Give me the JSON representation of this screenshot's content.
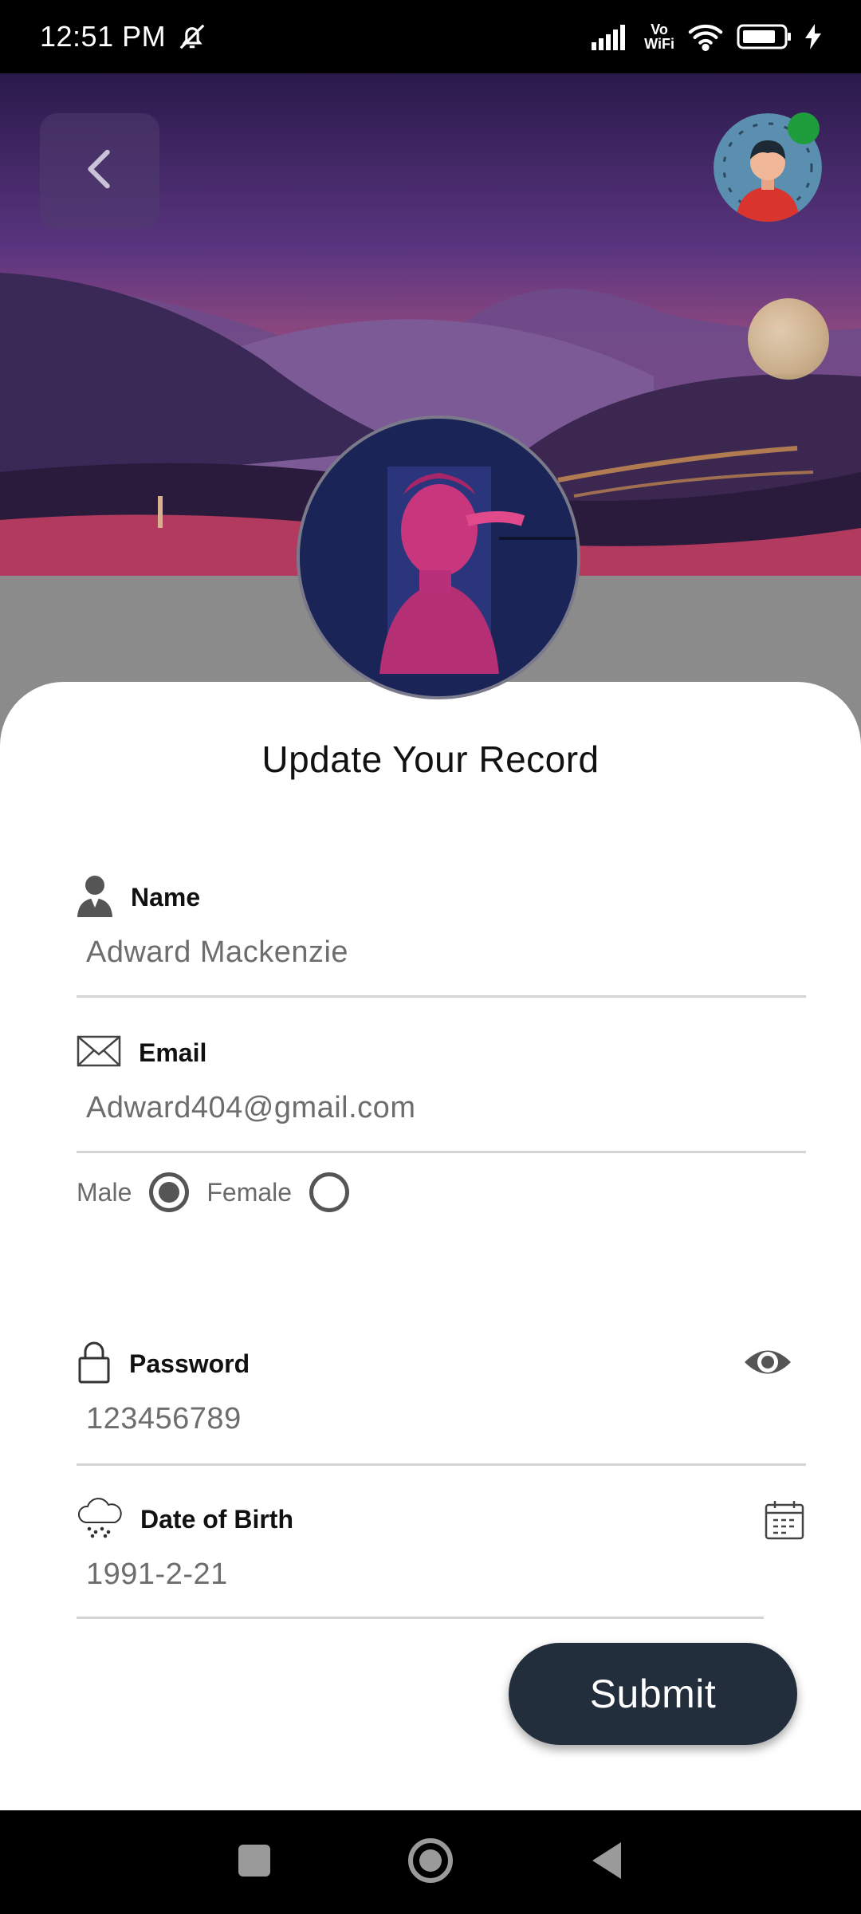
{
  "status_bar": {
    "time": "12:51 PM",
    "icons": [
      "silent-bell-icon",
      "signal-icon",
      "vowifi-icon",
      "wifi-icon",
      "battery-icon",
      "charging-icon"
    ],
    "vowifi_top": "Vo",
    "vowifi_bottom": "WiFi"
  },
  "header": {
    "back_icon": "chevron-left-icon"
  },
  "form": {
    "title": "Update Your Record",
    "name": {
      "label": "Name",
      "value": "Adward Mackenzie",
      "icon": "user-icon"
    },
    "email": {
      "label": "Email",
      "value": "Adward404@gmail.com",
      "icon": "envelope-icon"
    },
    "gender": {
      "male_label": "Male",
      "female_label": "Female",
      "selected": "Male"
    },
    "password": {
      "label": "Password",
      "value": "123456789",
      "icon": "lock-icon",
      "toggle_icon": "eye-icon"
    },
    "dob": {
      "label": "Date of Birth",
      "value": "1991-2-21",
      "icon": "cloud-icon",
      "picker_icon": "calendar-icon"
    },
    "submit_label": "Submit"
  },
  "colors": {
    "accent": "#222e3c",
    "online": "#1f9d3c",
    "label": "#111111",
    "value": "#6d6d6d"
  },
  "nav_bar": {
    "icons": [
      "recent-apps-icon",
      "home-icon",
      "back-icon"
    ]
  }
}
